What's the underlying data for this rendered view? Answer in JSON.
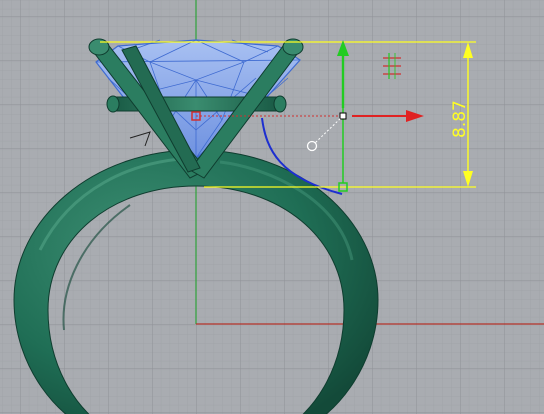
{
  "viewport": {
    "background": "#a9acb1",
    "grid_minor_color": "#9ea1a6",
    "grid_major_color": "#8f9297",
    "x_axis_color": "#b4322a",
    "y_axis_color": "#2fa33a"
  },
  "model": {
    "ring_color": "#1f6e55",
    "ring_highlight": "#4fa286",
    "gem_fill": "#7d9fe6",
    "gem_wire": "#3f6bd1",
    "selection_curve": "#1d2fd0"
  },
  "gumball": {
    "x_arrow_color": "#e02222",
    "y_arrow_color": "#22cc22",
    "scale_marker_color": "#d03030"
  },
  "dimension": {
    "value": "8.87",
    "color": "#ffff22"
  },
  "icons": {
    "gumball_x_arrow": "arrow-right-icon",
    "gumball_y_arrow": "arrow-up-icon",
    "rotate_handle": "circle-handle-icon",
    "scale_marker": "scale-marker-icon"
  }
}
